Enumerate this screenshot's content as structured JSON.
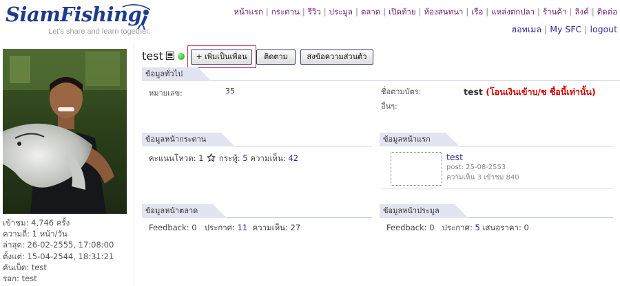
{
  "brand": {
    "name": "SiamFishing",
    "tagline": "Let's share and learn together."
  },
  "nav": {
    "main": [
      "หน้าแรก",
      "กระดาน",
      "รีวิว",
      "ประมูล",
      "ตลาด",
      "เปิดท้าย",
      "ห้องสนทนา",
      "เรือ",
      "แหล่งตกปลา",
      "ร้านค้า",
      "ลิงค์",
      "ติดต่อ"
    ],
    "user": [
      "ฮอทเมล",
      "My SFC",
      "logout"
    ]
  },
  "colors": {
    "nav_link": "#6b1a70",
    "link": "#2a2a8c",
    "online": "#0c9c0c",
    "highlight_box": "#c0305a",
    "cardname_note": "#d40000"
  },
  "profile": {
    "username": "test",
    "icons": [
      "id-card-icon",
      "online-status-icon"
    ],
    "buttons": {
      "add_friend": "+ เพิ่มเป็นเพื่อน",
      "follow": "ติดตาม",
      "message": "ส่งข้อความส่วนตัว"
    }
  },
  "stats": {
    "visits": "เข้าชม: 4,746 ครั้ง",
    "frequency": "ความถี่: 1 หน้า/วัน",
    "last_seen": "ล่าสุด: 26-02-2555, 17:08:00",
    "since": "ตั้งแต่: 15-04-2544, 18:31:21",
    "introduced_by": "คันเบ็ด: test",
    "waiting": "รอก: test"
  },
  "sections": {
    "general": {
      "title": "ข้อมูลทั่วไป",
      "member_no_label": "หมายเลข:",
      "member_no": "35",
      "cardname_label": "ชื่อตามบัตร:",
      "cardname": "test",
      "cardname_note": "(โอนเงินเข้าบ/ช ชื่อนี้เท่านั้น)",
      "other_label": "อื่นๆ:"
    },
    "board": {
      "title": "ข้อมูลหน้ากระดาน",
      "score_label": "คะแนนโหวต:",
      "score": "1",
      "threads_label": "กระทู้:",
      "threads": "5",
      "comments_label": "ความเห็น:",
      "comments": "42"
    },
    "home": {
      "title": "ข้อมูลหน้าแรก",
      "post_title": "test",
      "post_date": "post: 25-08-2553",
      "post_meta": "ความเห็น 3  เข้าชม 840"
    },
    "market": {
      "title": "ข้อมูลหน้าตลาด",
      "feedback_label": "Feedback:",
      "feedback": "0",
      "listings_label": "ประกาศ:",
      "listings": "11",
      "comments_label": "ความเห็น:",
      "comments": "27"
    },
    "auction": {
      "title": "ข้อมูลหน้าประมูล",
      "feedback_label": "Feedback:",
      "feedback": "0",
      "listings_label": "ประกาศ:",
      "listings": "5",
      "bids_label": "เสนอราคา:",
      "bids": "0"
    }
  }
}
